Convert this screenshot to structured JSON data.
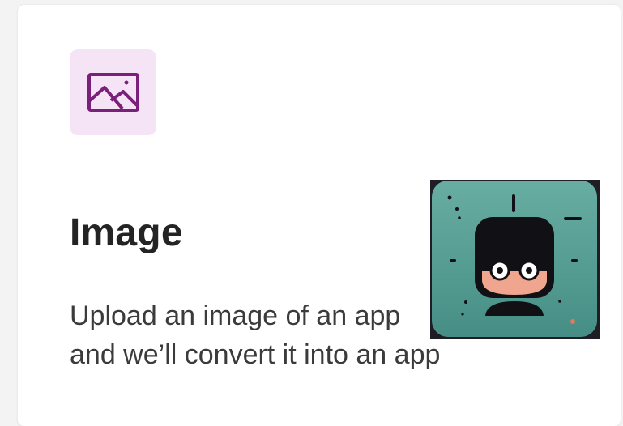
{
  "card": {
    "icon": "image-icon",
    "title": "Image",
    "description_line1": "Upload an image of an app",
    "description_line2": "and we’ll convert it into an app"
  },
  "overlay": {
    "icon": "nerd-avatar-icon"
  },
  "colors": {
    "icon_tile_bg": "#f5e4f5",
    "icon_stroke": "#7a1f7a",
    "avatar_bg": "#5fa59a"
  }
}
